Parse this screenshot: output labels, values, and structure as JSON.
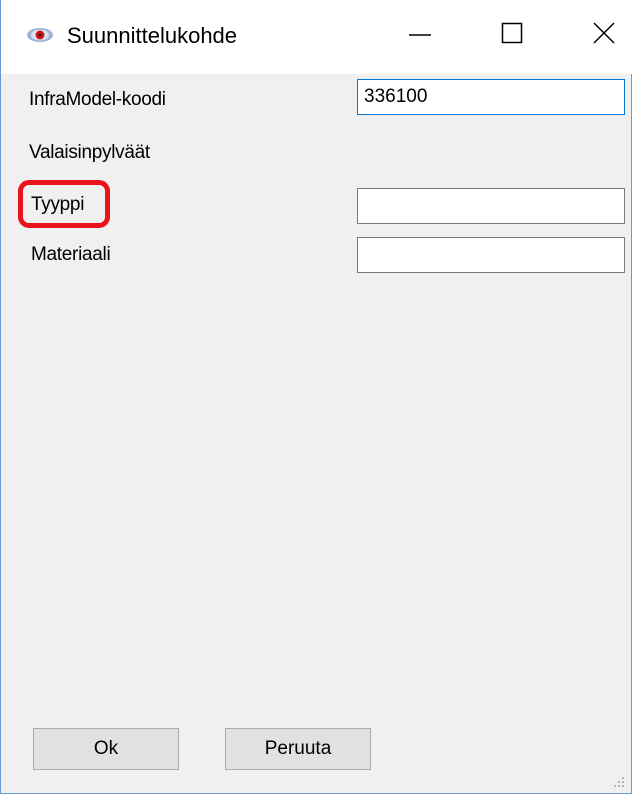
{
  "window": {
    "title": "Suunnittelukohde",
    "icon": "eye-icon",
    "controls": {
      "minimize": "minimize-icon",
      "maximize": "maximize-icon",
      "close": "close-icon"
    }
  },
  "form": {
    "inframodel_label": "InfraModel-koodi",
    "inframodel_value": "336100",
    "category_label": "Valaisinpylväät",
    "tyyppi_label": "Tyyppi",
    "tyyppi_value": "",
    "materiaali_label": "Materiaali",
    "materiaali_value": ""
  },
  "buttons": {
    "ok_label": "Ok",
    "cancel_label": "Peruuta"
  },
  "colors": {
    "highlight": "#e8131b",
    "focus_border": "#0078d7",
    "window_bg": "#f0f0f0"
  }
}
